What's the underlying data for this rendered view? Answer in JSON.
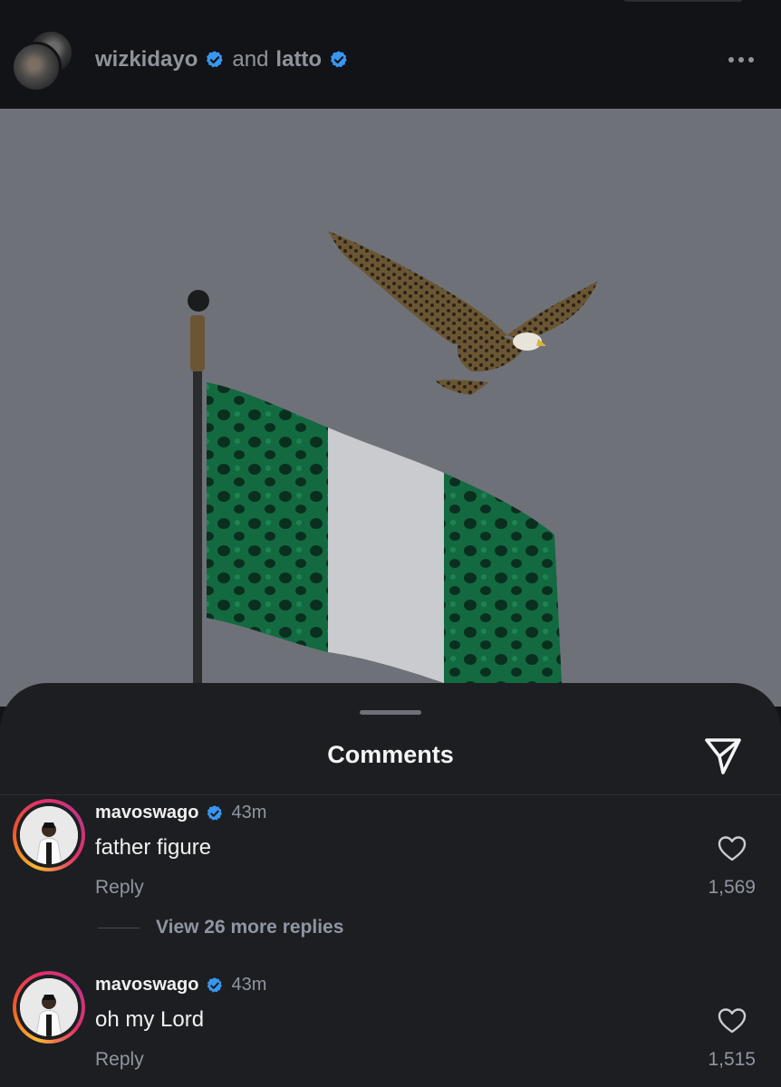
{
  "header": {
    "user1": "wizkidayo",
    "connector": "and",
    "user2": "latto"
  },
  "sheet": {
    "title": "Comments"
  },
  "comments": [
    {
      "username": "mavoswago",
      "time": "43m",
      "text": "father figure",
      "reply_label": "Reply",
      "likes": "1,569",
      "view_more": "View 26 more replies"
    },
    {
      "username": "mavoswago",
      "time": "43m",
      "text": "oh my Lord",
      "reply_label": "Reply",
      "likes": "1,515"
    }
  ],
  "colors": {
    "verified": "#3897f0",
    "flag_green": "#0f8a4d",
    "flag_white": "#e6e6e6",
    "sheet_bg": "#1c1e22"
  },
  "icons": [
    "verified-badge-icon",
    "more-options-icon",
    "share-icon",
    "heart-icon"
  ]
}
